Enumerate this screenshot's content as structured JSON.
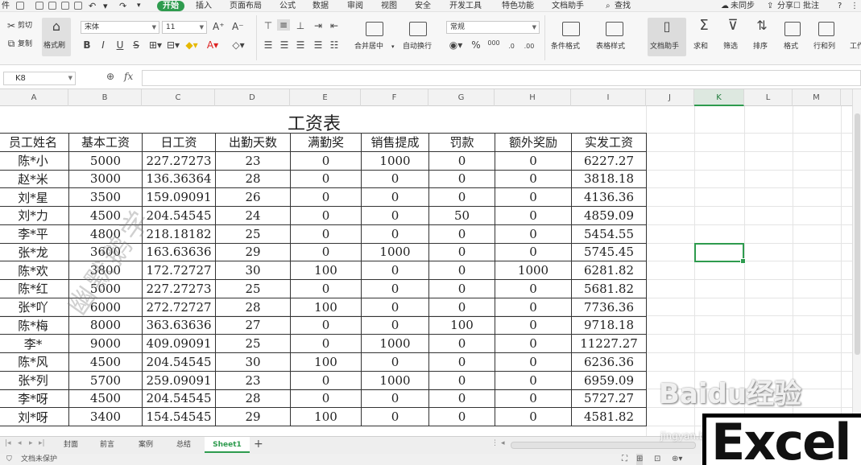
{
  "menubar": {
    "file": "件",
    "tabs": [
      "开始",
      "插入",
      "页面布局",
      "公式",
      "数据",
      "审阅",
      "视图",
      "安全",
      "开发工具",
      "特色功能",
      "文档助手"
    ],
    "search": "查找",
    "sync": "未同步",
    "share": "分享",
    "comment": "批注",
    "help": "?"
  },
  "ribbon": {
    "cut": "剪切",
    "copy": "复制",
    "format_painter": "格式刷",
    "font_name": "宋体",
    "font_size": "11",
    "bold": "B",
    "italic": "I",
    "underline": "U",
    "strike": "S",
    "merge": "合并居中",
    "wrap": "自动换行",
    "number_format": "常规",
    "percent": "%",
    "thousands": "000",
    "inc_decimal": ".0",
    "dec_decimal": ".00",
    "cond_format": "条件格式",
    "table_style": "表格样式",
    "doc_assistant": "文档助手",
    "sum": "求和",
    "filter": "筛选",
    "sort": "排序",
    "format": "格式",
    "rowcol": "行和列",
    "worksheet": "工作"
  },
  "formula_bar": {
    "name_box": "K8",
    "fx": "fx",
    "value": ""
  },
  "columns": [
    "A",
    "B",
    "C",
    "D",
    "E",
    "F",
    "G",
    "H",
    "I",
    "J",
    "K",
    "L",
    "M"
  ],
  "active_column": "K",
  "sheet": {
    "title": "工资表",
    "headers": [
      "员工姓名",
      "基本工资",
      "日工资",
      "出勤天数",
      "满勤奖",
      "销售提成",
      "罚款",
      "额外奖励",
      "实发工资"
    ],
    "rows": [
      [
        "陈*小",
        "5000",
        "227.27273",
        "23",
        "0",
        "1000",
        "0",
        "0",
        "6227.27"
      ],
      [
        "赵*米",
        "3000",
        "136.36364",
        "28",
        "0",
        "0",
        "0",
        "0",
        "3818.18"
      ],
      [
        "刘*星",
        "3500",
        "159.09091",
        "26",
        "0",
        "0",
        "0",
        "0",
        "4136.36"
      ],
      [
        "刘*力",
        "4500",
        "204.54545",
        "24",
        "0",
        "0",
        "50",
        "0",
        "4859.09"
      ],
      [
        "李*平",
        "4800",
        "218.18182",
        "25",
        "0",
        "0",
        "0",
        "0",
        "5454.55"
      ],
      [
        "张*龙",
        "3600",
        "163.63636",
        "29",
        "0",
        "1000",
        "0",
        "0",
        "5745.45"
      ],
      [
        "陈*欢",
        "3800",
        "172.72727",
        "30",
        "100",
        "0",
        "0",
        "1000",
        "6281.82"
      ],
      [
        "陈*红",
        "5000",
        "227.27273",
        "25",
        "0",
        "0",
        "0",
        "0",
        "5681.82"
      ],
      [
        "张*吖",
        "6000",
        "272.72727",
        "28",
        "100",
        "0",
        "0",
        "0",
        "7736.36"
      ],
      [
        "陈*梅",
        "8000",
        "363.63636",
        "27",
        "0",
        "0",
        "100",
        "0",
        "9718.18"
      ],
      [
        "李*",
        "9000",
        "409.09091",
        "25",
        "0",
        "1000",
        "0",
        "0",
        "11227.27"
      ],
      [
        "陈*风",
        "4500",
        "204.54545",
        "30",
        "100",
        "0",
        "0",
        "0",
        "6236.36"
      ],
      [
        "张*列",
        "5700",
        "259.09091",
        "23",
        "0",
        "1000",
        "0",
        "0",
        "6959.09"
      ],
      [
        "李*呀",
        "4500",
        "204.54545",
        "28",
        "0",
        "0",
        "0",
        "0",
        "5727.27"
      ],
      [
        "刘*呀",
        "3400",
        "154.54545",
        "29",
        "100",
        "0",
        "0",
        "0",
        "4581.82"
      ]
    ],
    "watermark": "幽默鹅学"
  },
  "tabs": {
    "items": [
      "封面",
      "前言",
      "案例",
      "总结",
      "Sheet1"
    ],
    "active": "Sheet1",
    "add": "+"
  },
  "status": {
    "protect": "文档未保护"
  },
  "overlay": {
    "baidu": "Baidu经验",
    "baidu_url": "jingyan.baidu.com",
    "excel": "Excel"
  },
  "colors": {
    "accent": "#2e9b4e",
    "grid": "#e4e4e4",
    "border": "#333333"
  }
}
